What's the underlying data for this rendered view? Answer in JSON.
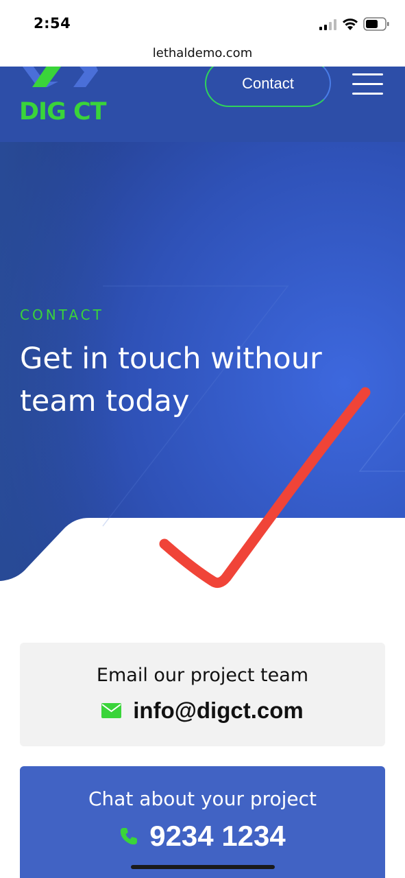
{
  "status_bar": {
    "time": "2:54",
    "icons": [
      "signal-icon",
      "wifi-icon",
      "battery-icon"
    ]
  },
  "browser": {
    "url": "lethaldemo.com"
  },
  "header": {
    "logo_text": "DIG CT",
    "contact_label": "Contact",
    "menu_icon": "hamburger-menu-icon"
  },
  "hero": {
    "eyebrow": "CONTACT",
    "title": "Get in touch withour team today"
  },
  "email_card": {
    "label": "Email our project team",
    "icon": "mail-icon",
    "email": "info@digct.com"
  },
  "chat_card": {
    "label": "Chat about your project",
    "icon": "phone-icon",
    "phone": "9234 1234"
  },
  "colors": {
    "brand_blue": "#2d4ea8",
    "brand_green": "#3ad43a",
    "card_blue": "#4163c4",
    "card_gray": "#f2f2f2",
    "annotation_red": "#f04438"
  }
}
